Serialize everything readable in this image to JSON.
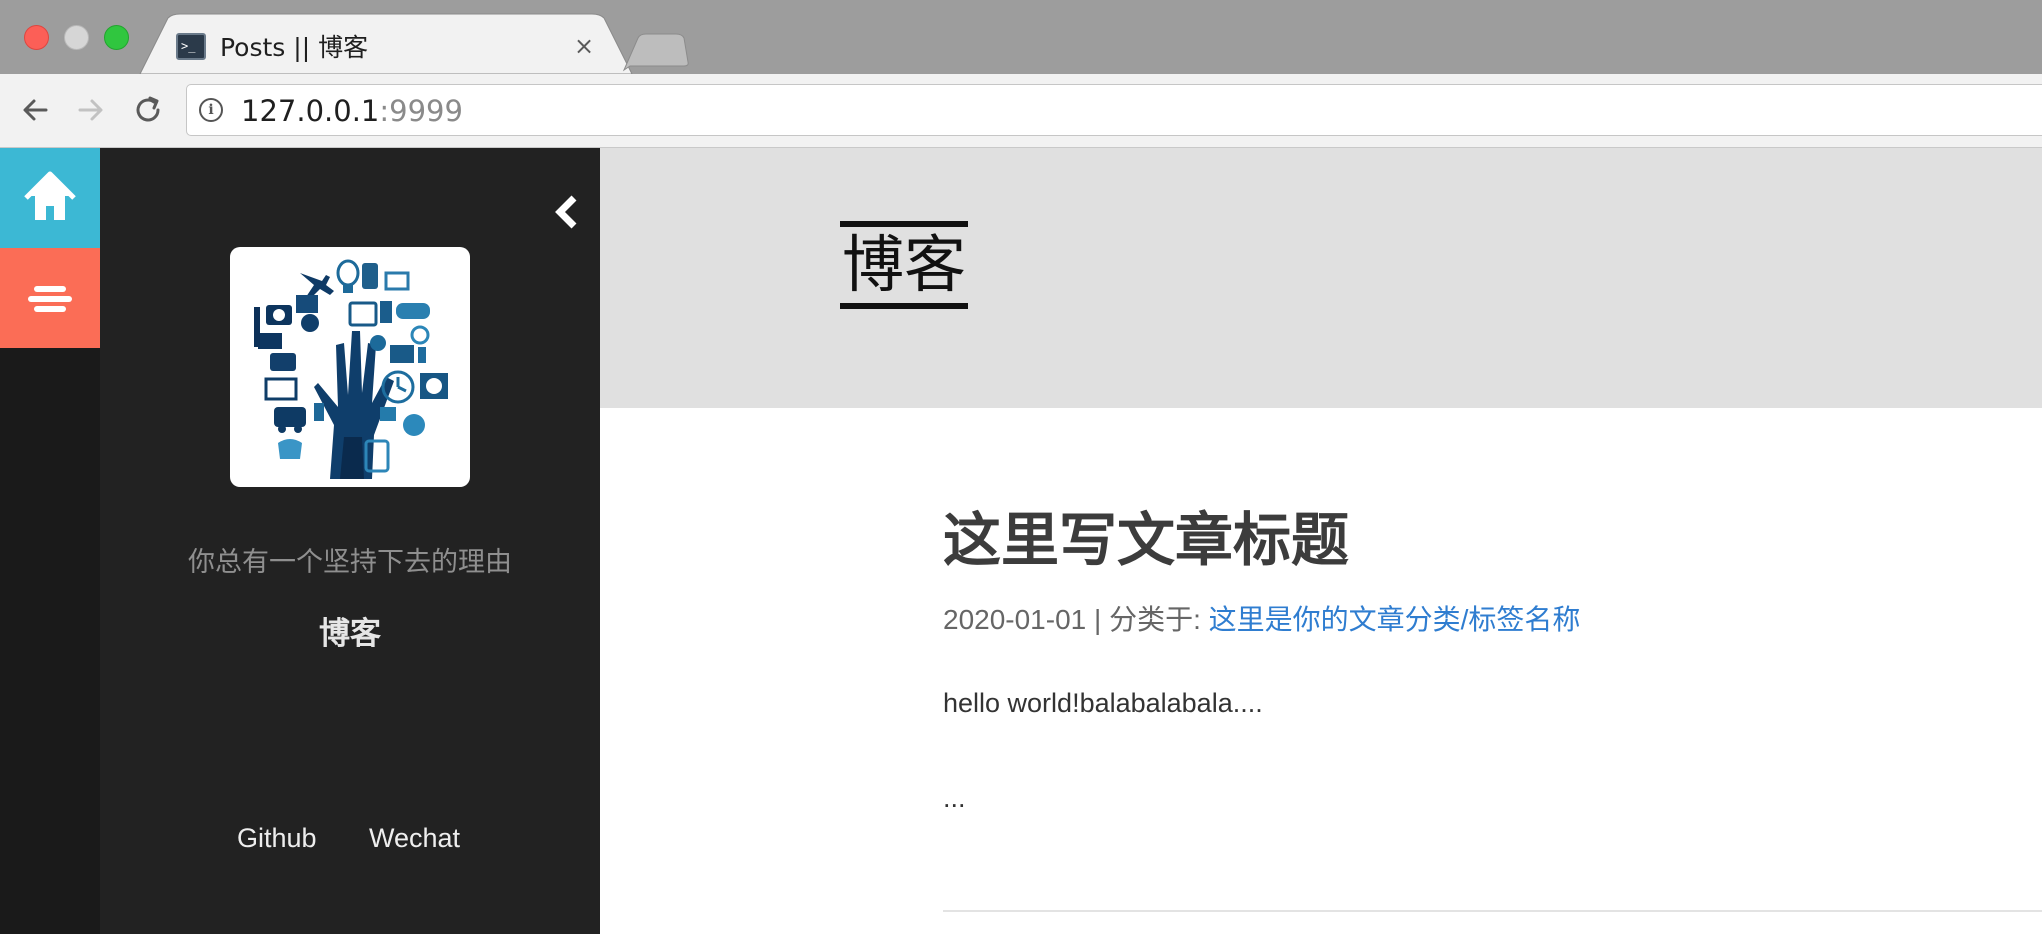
{
  "browser": {
    "tab": {
      "title": "Posts || 博客",
      "close_symbol": "×",
      "favicon_text": ">_"
    },
    "address": {
      "host": "127.0.0.1",
      "port": ":9999"
    }
  },
  "sidebar": {
    "motto": "你总有一个坚持下去的理由",
    "name": "博客",
    "links": [
      {
        "label": "Github"
      },
      {
        "label": "Wechat"
      }
    ]
  },
  "header": {
    "site_title": "博客"
  },
  "post": {
    "title": "这里写文章标题",
    "date": "2020-01-01",
    "meta_separator": " | 分类于: ",
    "category": "这里是你的文章分类/标签名称",
    "excerpt": "hello world!balabalabala....",
    "more": "..."
  },
  "colors": {
    "home_button": "#3cb8d4",
    "menu_button": "#fb6d56",
    "sidebar_bg": "#222222",
    "hero_bg": "#e0e0e0",
    "link": "#2f7dd0"
  }
}
